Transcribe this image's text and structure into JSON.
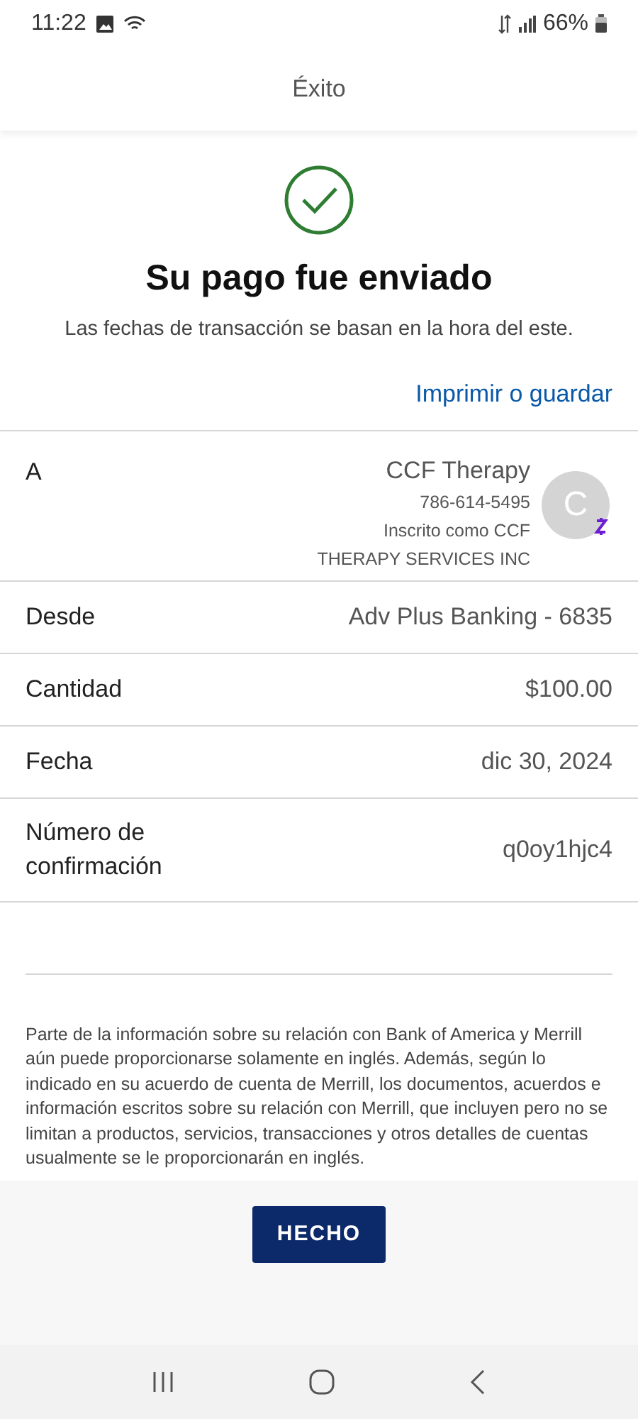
{
  "status_bar": {
    "time": "11:22",
    "battery": "66%"
  },
  "header": {
    "title": "Éxito"
  },
  "confirmation": {
    "heading": "Su pago fue enviado",
    "subtitle": "Las fechas de transacción se basan en la hora del este.",
    "print_link": "Imprimir o guardar"
  },
  "rows": [
    {
      "kind": "recipient",
      "label": "A",
      "name": "CCF Therapy",
      "details": [
        "786-614-5495",
        "Inscrito como CCF",
        "THERAPY SERVICES INC"
      ],
      "avatar": "C"
    },
    {
      "kind": "plain",
      "label": "Desde",
      "value": "Adv Plus Banking - 6835"
    },
    {
      "kind": "plain",
      "label": "Cantidad",
      "value": "$100.00"
    },
    {
      "kind": "plain",
      "label": "Fecha",
      "value": "dic 30, 2024"
    },
    {
      "kind": "plain",
      "label": "Número de confirmación",
      "value": "q0oy1hjc4"
    }
  ],
  "disclaimer": "Parte de la información sobre su relación con Bank of America y Merrill aún puede proporcionarse solamente en inglés. Además, según lo indicado en su acuerdo de cuenta de Merrill, los documentos, acuerdos e información escritos sobre su relación con Merrill, que incluyen pero no se limitan a productos, servicios, transacciones y otros detalles de cuentas usualmente se le proporcionarán en inglés.",
  "done_button": "HECHO"
}
